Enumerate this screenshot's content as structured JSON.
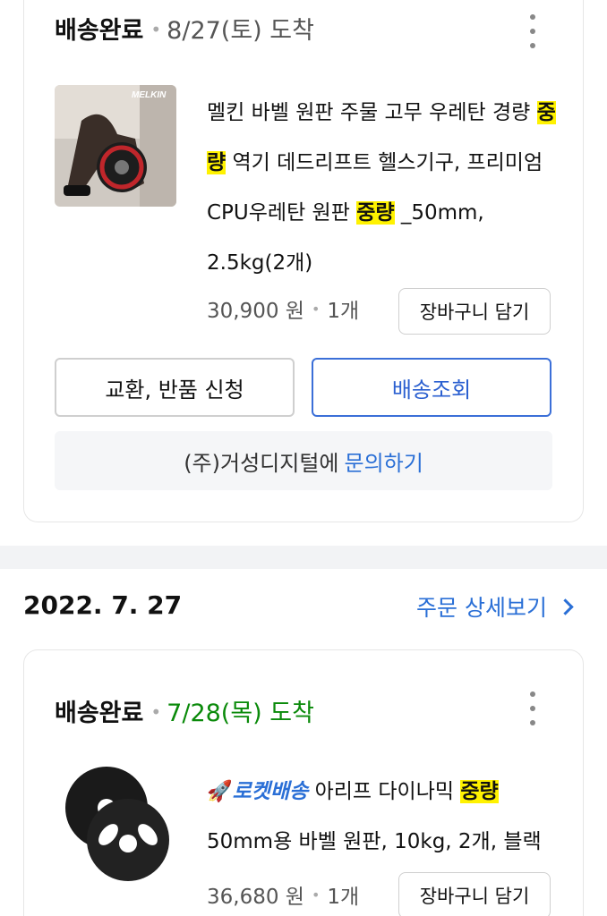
{
  "order1": {
    "status": "배송완료",
    "arrival": "8/27(토) 도착",
    "product": {
      "title_part1": "멜킨 바벨 원판 주물 고무 우레탄 경량 ",
      "highlight1": "중량",
      "title_part2": " 역기 데드리프트 헬스기구, 프리미엄 CPU우레탄 원판 ",
      "highlight2": "중량",
      "title_part3": " _50mm, 2.5kg(2개)",
      "price": "30,900 원",
      "qty": "1개",
      "thumb_brand": "MELKIN"
    },
    "cart_label": "장바구니 담기",
    "exchange_label": "교환, 반품 신청",
    "track_label": "배송조회",
    "seller": "(주)거성디지털에",
    "inquiry_link": "문의하기"
  },
  "order2_header": {
    "date": "2022. 7. 27",
    "detail_link": "주문 상세보기"
  },
  "order2": {
    "status": "배송완료",
    "arrival": "7/28(목) 도착",
    "product": {
      "rocket": "로켓배송",
      "title_part1": " 아리프 다이나믹 ",
      "highlight1": "중량",
      "title_part2": " 50mm용 바벨 원판, 10kg, 2개, 블랙",
      "price": "36,680 원",
      "qty": "1개"
    },
    "cart_label": "장바구니 담기"
  },
  "colors": {
    "accent_blue": "#2a6fd6",
    "highlight": "#fff200",
    "arrival_green": "#0a8a0a"
  }
}
